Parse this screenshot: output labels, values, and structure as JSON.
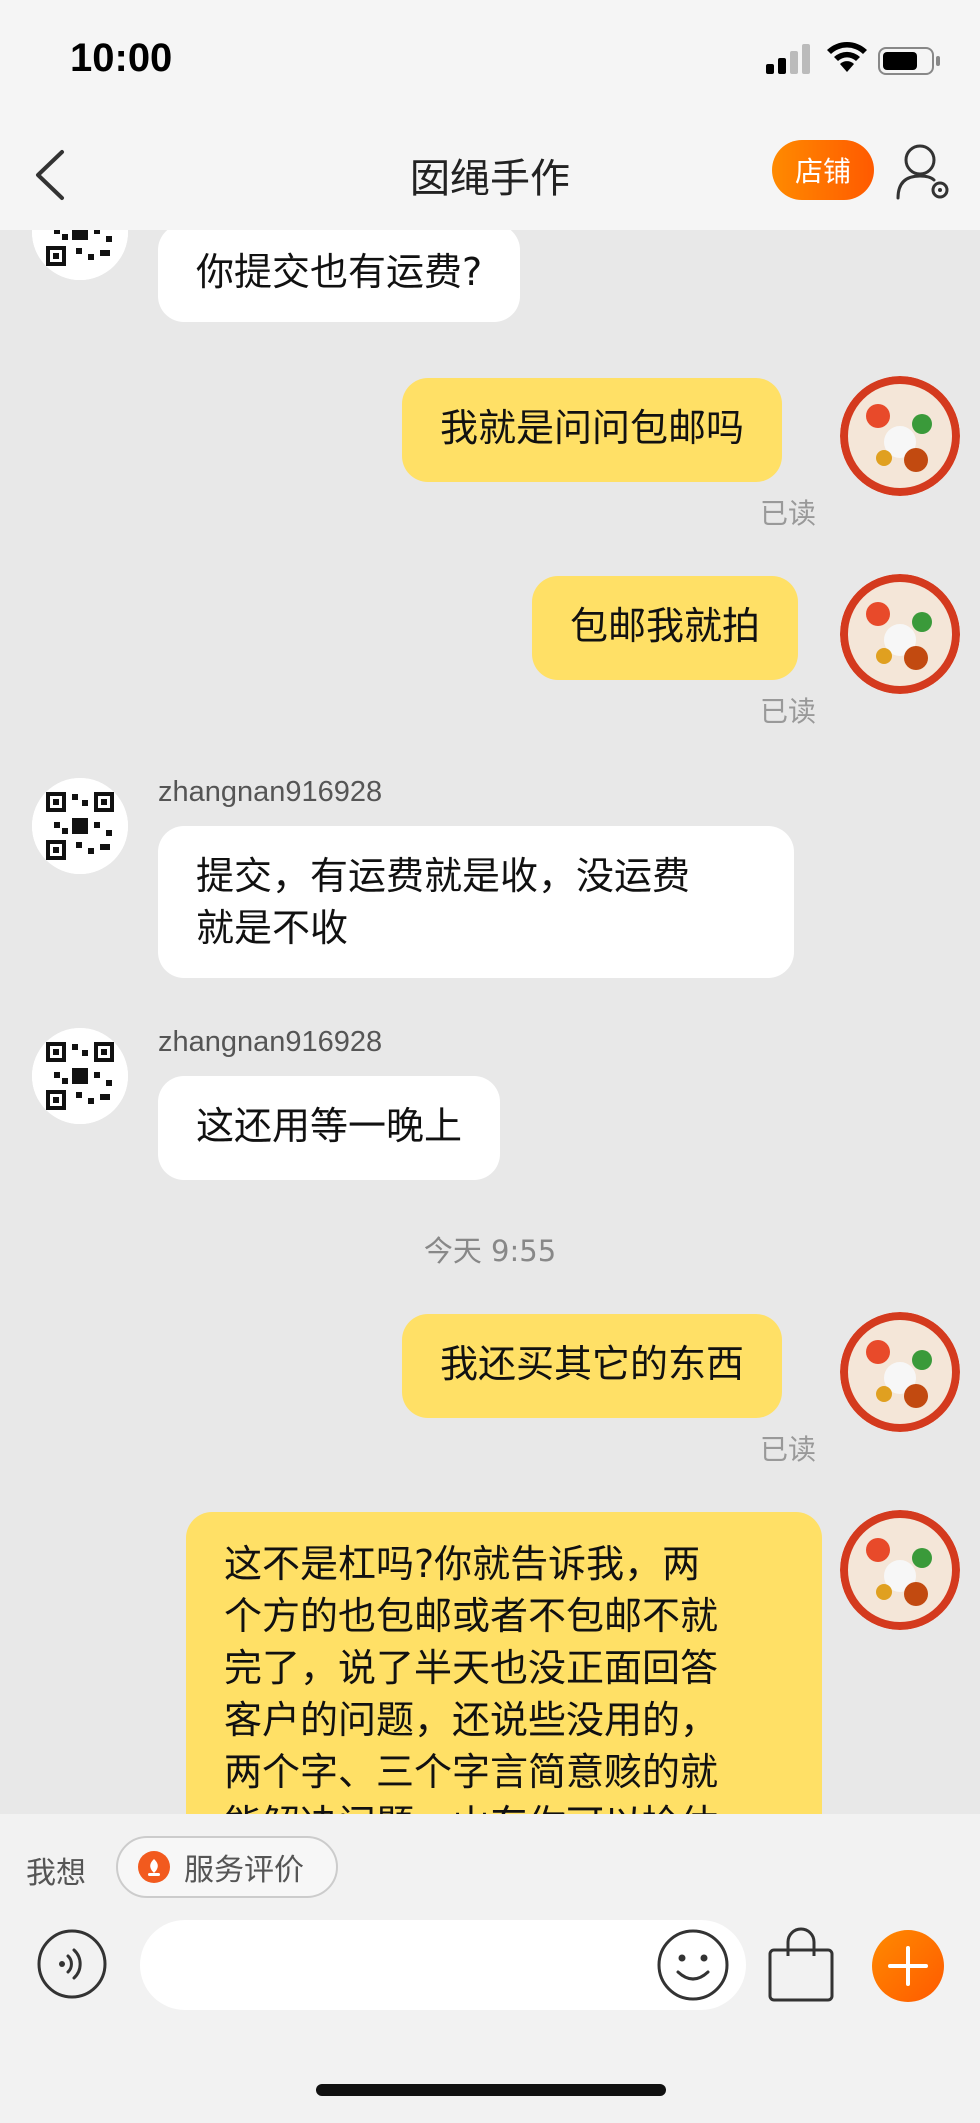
{
  "status_bar": {
    "time": "10:00"
  },
  "nav": {
    "title": "囡绳手作",
    "store_label": "店铺"
  },
  "messages": [
    {
      "side": "left",
      "text": "你提交也有运费?"
    },
    {
      "side": "right",
      "text": "我就是问问包邮吗",
      "status": "已读"
    },
    {
      "side": "right",
      "text": "包邮我就拍",
      "status": "已读"
    },
    {
      "side": "left",
      "sender": "zhangnan916928",
      "text_lines": [
        "提交，有运费就是收，没运费",
        "就是不收"
      ]
    },
    {
      "side": "left",
      "sender": "zhangnan916928",
      "text": "这还用等一晚上"
    },
    {
      "type": "time",
      "text": "今天 9:55"
    },
    {
      "side": "right",
      "text": "我还买其它的东西",
      "status": "已读"
    },
    {
      "side": "right",
      "text_lines": [
        "这不是杠吗?你就告诉我，两",
        "个方的也包邮或者不包邮不就",
        "完了，说了半天也没正面回答",
        "客户的问题，还说些没用的，",
        "两个字、三个字言简意赅的就",
        "能解决问题，山东你可以捡估"
      ]
    }
  ],
  "bottom": {
    "want_label": "我想",
    "chip_label": "服务评价",
    "input_placeholder": ""
  },
  "colors": {
    "accent": "#ff6a00",
    "bubble_self": "#ffe066",
    "bubble_other": "#ffffff",
    "chat_background": "#e8e8e8"
  },
  "icons": [
    "back-icon",
    "profile-settings-icon",
    "voice-icon",
    "emoji-icon",
    "shopping-bag-icon",
    "plus-icon",
    "service-rating-icon"
  ]
}
